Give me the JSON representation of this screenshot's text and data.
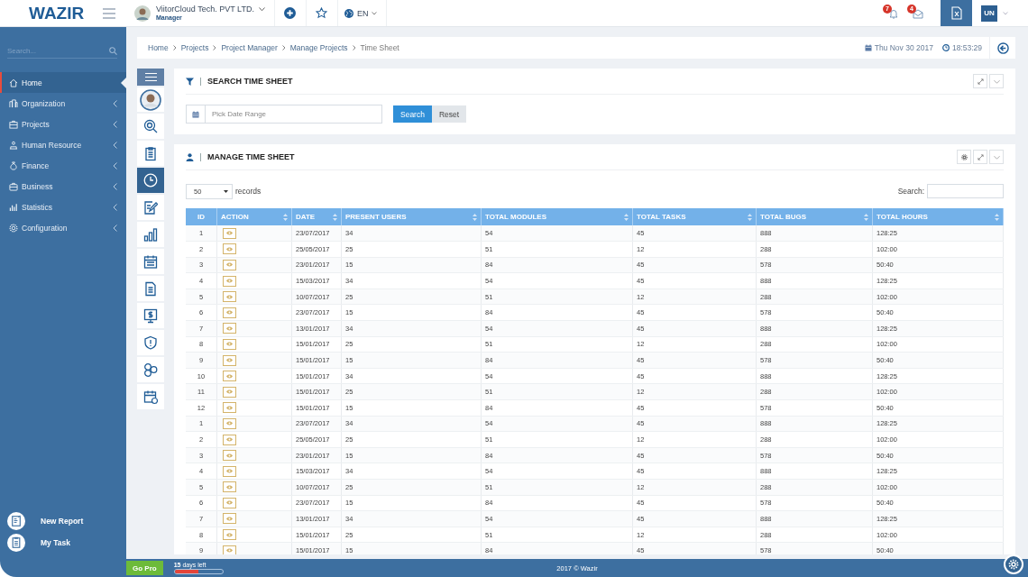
{
  "logo": {
    "text": "WAZIR"
  },
  "topbar": {
    "company": "ViitorCloud Tech. PVT LTD.",
    "role": "Manager",
    "language": "EN",
    "notifications": "7",
    "messages": "4",
    "user_initials": "UN"
  },
  "sidebar": {
    "search": {
      "placeholder": "Search..."
    },
    "items": [
      {
        "label": "Home",
        "selected": true,
        "expandable": false
      },
      {
        "label": "Organization",
        "selected": false,
        "expandable": true
      },
      {
        "label": "Projects",
        "selected": false,
        "expandable": true
      },
      {
        "label": "Human Resource",
        "selected": false,
        "expandable": true
      },
      {
        "label": "Finance",
        "selected": false,
        "expandable": true
      },
      {
        "label": "Business",
        "selected": false,
        "expandable": true
      },
      {
        "label": "Statistics",
        "selected": false,
        "expandable": true
      },
      {
        "label": "Configuration",
        "selected": false,
        "expandable": true
      }
    ],
    "shortcuts": [
      "New Report",
      "My Task"
    ]
  },
  "breadcrumb": [
    "Home",
    "Projects",
    "Project Manager",
    "Manage Projects",
    "Time Sheet"
  ],
  "date": "Thu Nov 30 2017",
  "time": "18:53:29",
  "tool_column": [
    {
      "kind": "search",
      "selected": false
    },
    {
      "kind": "clipboard",
      "selected": false
    },
    {
      "kind": "clock",
      "selected": true
    },
    {
      "kind": "edit",
      "selected": false
    },
    {
      "kind": "bars",
      "selected": false
    },
    {
      "kind": "calendar",
      "selected": false
    },
    {
      "kind": "document",
      "selected": false
    },
    {
      "kind": "dollar",
      "selected": false
    },
    {
      "kind": "shield",
      "selected": false
    },
    {
      "kind": "circles",
      "selected": false
    },
    {
      "kind": "schedule",
      "selected": false
    }
  ],
  "search_panel": {
    "title": "SEARCH TIME SHEET",
    "date_field": {
      "placeholder": "Pick Date Range"
    },
    "buttons": [
      "Search",
      "Reset"
    ]
  },
  "manage_panel": {
    "title": "MANAGE TIME SHEET",
    "page_size": "50",
    "records_label": "records",
    "search_label": "Search:",
    "columns": [
      "ID",
      "ACTION",
      "DATE",
      "PRESENT USERS",
      "TOTAL MODULES",
      "TOTAL TASKS",
      "TOTAL BUGS",
      "TOTAL HOURS"
    ],
    "rows": [
      [
        "1",
        "",
        "23/07/2017",
        "34",
        "54",
        "45",
        "888",
        "128:25"
      ],
      [
        "2",
        "",
        "25/05/2017",
        "25",
        "51",
        "12",
        "288",
        "102:00"
      ],
      [
        "3",
        "",
        "23/01/2017",
        "15",
        "84",
        "45",
        "578",
        "50:40"
      ],
      [
        "4",
        "",
        "15/03/2017",
        "34",
        "54",
        "45",
        "888",
        "128:25"
      ],
      [
        "5",
        "",
        "10/07/2017",
        "25",
        "51",
        "12",
        "288",
        "102:00"
      ],
      [
        "6",
        "",
        "23/07/2017",
        "15",
        "84",
        "45",
        "578",
        "50:40"
      ],
      [
        "7",
        "",
        "13/01/2017",
        "34",
        "54",
        "45",
        "888",
        "128:25"
      ],
      [
        "8",
        "",
        "15/01/2017",
        "25",
        "51",
        "12",
        "288",
        "102:00"
      ],
      [
        "9",
        "",
        "15/01/2017",
        "15",
        "84",
        "45",
        "578",
        "50:40"
      ],
      [
        "10",
        "",
        "15/01/2017",
        "34",
        "54",
        "45",
        "888",
        "128:25"
      ],
      [
        "11",
        "",
        "15/01/2017",
        "25",
        "51",
        "12",
        "288",
        "102:00"
      ],
      [
        "12",
        "",
        "15/01/2017",
        "15",
        "84",
        "45",
        "578",
        "50:40"
      ],
      [
        "1",
        "",
        "23/07/2017",
        "34",
        "54",
        "45",
        "888",
        "128:25"
      ],
      [
        "2",
        "",
        "25/05/2017",
        "25",
        "51",
        "12",
        "288",
        "102:00"
      ],
      [
        "3",
        "",
        "23/01/2017",
        "15",
        "84",
        "45",
        "578",
        "50:40"
      ],
      [
        "4",
        "",
        "15/03/2017",
        "34",
        "54",
        "45",
        "888",
        "128:25"
      ],
      [
        "5",
        "",
        "10/07/2017",
        "25",
        "51",
        "12",
        "288",
        "102:00"
      ],
      [
        "6",
        "",
        "23/07/2017",
        "15",
        "84",
        "45",
        "578",
        "50:40"
      ],
      [
        "7",
        "",
        "13/01/2017",
        "34",
        "54",
        "45",
        "888",
        "128:25"
      ],
      [
        "8",
        "",
        "15/01/2017",
        "25",
        "51",
        "12",
        "288",
        "102:00"
      ],
      [
        "9",
        "",
        "15/01/2017",
        "15",
        "84",
        "45",
        "578",
        "50:40"
      ]
    ]
  },
  "footer": {
    "upgrade_button": "Go Pro",
    "days_count": "15",
    "days_text": "days left",
    "trial": {
      "level": 0.5
    },
    "copyright": "2017 © Wazir"
  }
}
